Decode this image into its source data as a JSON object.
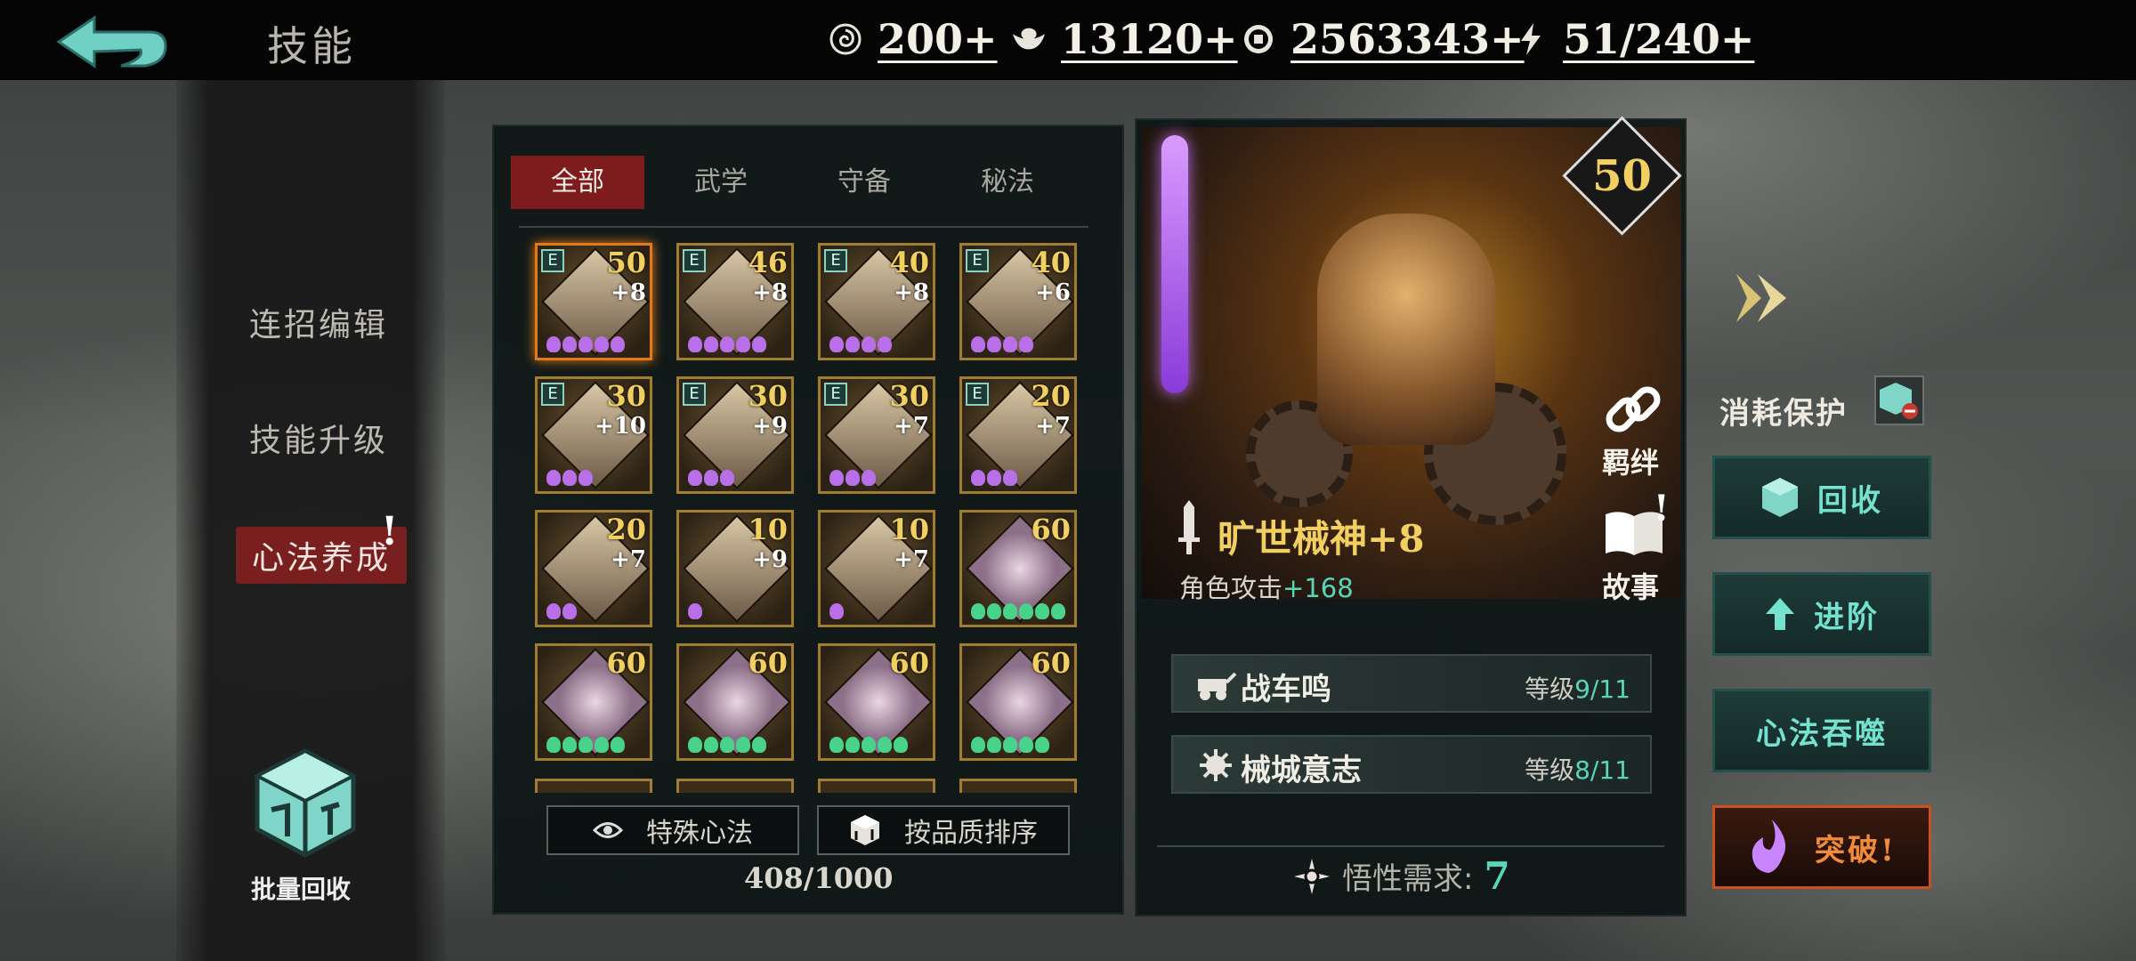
{
  "header": {
    "title": "技能",
    "back_icon": "back-arrow-icon"
  },
  "resources": [
    {
      "icon": "spiral-coin-icon",
      "value": "200+"
    },
    {
      "icon": "silver-ingot-icon",
      "value": "13120+"
    },
    {
      "icon": "copper-coin-icon",
      "value": "2563343+"
    },
    {
      "icon": "lightning-icon",
      "value": "51/240+"
    }
  ],
  "side_menu": {
    "items": [
      "连招编辑",
      "技能升级",
      "心法养成"
    ],
    "active_index": 2,
    "alert": "!"
  },
  "batch_recycle": {
    "label": "批量回收",
    "icon": "recycle-cube-icon"
  },
  "tabs": {
    "items": [
      "全部",
      "武学",
      "守备",
      "秘法"
    ],
    "active_index": 0
  },
  "cards": [
    {
      "e": "E",
      "level": "50",
      "plus": "+8",
      "pips": 5,
      "pip_color": "purple"
    },
    {
      "e": "E",
      "level": "46",
      "plus": "+8",
      "pips": 5,
      "pip_color": "purple"
    },
    {
      "e": "E",
      "level": "40",
      "plus": "+8",
      "pips": 4,
      "pip_color": "purple"
    },
    {
      "e": "E",
      "level": "40",
      "plus": "+6",
      "pips": 4,
      "pip_color": "purple"
    },
    {
      "e": "E",
      "level": "30",
      "plus": "+10",
      "pips": 3,
      "pip_color": "purple"
    },
    {
      "e": "E",
      "level": "30",
      "plus": "+9",
      "pips": 3,
      "pip_color": "purple"
    },
    {
      "e": "E",
      "level": "30",
      "plus": "+7",
      "pips": 3,
      "pip_color": "purple"
    },
    {
      "e": "E",
      "level": "20",
      "plus": "+7",
      "pips": 3,
      "pip_color": "purple"
    },
    {
      "e": "",
      "level": "20",
      "plus": "+7",
      "pips": 2,
      "pip_color": "purple"
    },
    {
      "e": "",
      "level": "10",
      "plus": "+9",
      "pips": 1,
      "pip_color": "purple"
    },
    {
      "e": "",
      "level": "10",
      "plus": "+7",
      "pips": 1,
      "pip_color": "purple"
    },
    {
      "e": "",
      "level": "60",
      "plus": "",
      "pips": 6,
      "pip_color": "green"
    },
    {
      "e": "",
      "level": "60",
      "plus": "",
      "pips": 5,
      "pip_color": "green"
    },
    {
      "e": "",
      "level": "60",
      "plus": "",
      "pips": 5,
      "pip_color": "green"
    },
    {
      "e": "",
      "level": "60",
      "plus": "",
      "pips": 5,
      "pip_color": "green"
    },
    {
      "e": "",
      "level": "60",
      "plus": "",
      "pips": 5,
      "pip_color": "green"
    }
  ],
  "buttons": {
    "special": "特殊心法",
    "sort": "按品质排序"
  },
  "inventory_count": "408/1000",
  "detail": {
    "level": "50",
    "name": "旷世械神",
    "name_plus": "+8",
    "attr_label": "角色攻击",
    "attr_bonus": "+168",
    "bond_label": "羁绊",
    "story_label": "故事",
    "story_alert": "!",
    "skills": [
      {
        "name": "战车鸣",
        "level_label": "等级",
        "level_value": "9/11",
        "icon": "chariot-icon"
      },
      {
        "name": "械城意志",
        "level_label": "等级",
        "level_value": "8/11",
        "icon": "gear-spikes-icon"
      }
    ],
    "insight_label": "悟性需求:",
    "insight_value": "7"
  },
  "right": {
    "protect_label": "消耗保护",
    "recycle": "回收",
    "advance": "进阶",
    "devour": "心法吞噬",
    "breakthrough": "突破!"
  }
}
